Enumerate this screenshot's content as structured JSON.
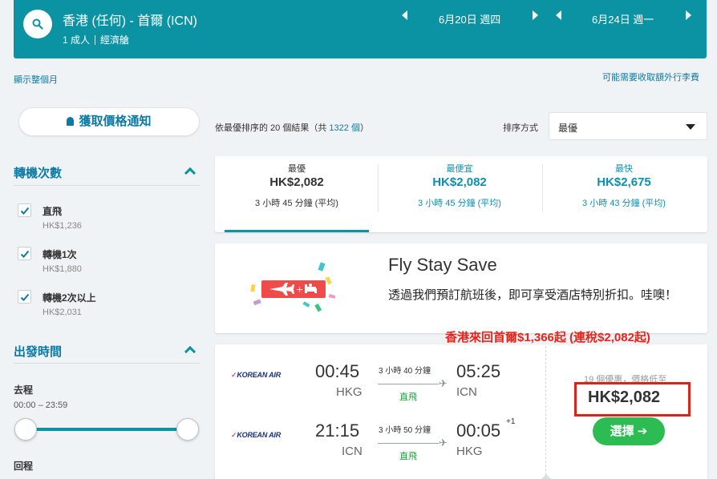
{
  "header": {
    "route": "香港 (任何) - 首爾 (ICN)",
    "passengers": "1 成人",
    "cabin": "經濟艙",
    "depart_date": "6月20日 週四",
    "return_date": "6月24日 週一",
    "bg_color": "#0b93a4"
  },
  "links": {
    "show_month": "顯示整個月",
    "baggage_fee": "可能需要收取額外行李費"
  },
  "sidebar": {
    "alert_button": "獲取價格通知",
    "stops_title": "轉機次數",
    "stops": [
      {
        "label": "直飛",
        "price": "HK$1,236",
        "checked": true
      },
      {
        "label": "轉機1次",
        "price": "HK$1,880",
        "checked": true
      },
      {
        "label": "轉機2次以上",
        "price": "HK$2,031",
        "checked": true
      }
    ],
    "times_title": "出發時間",
    "outbound_label": "去程",
    "outbound_range": "00:00 – 23:59",
    "return_label": "回程"
  },
  "results": {
    "prefix": "依最優排序的 20 個結果（共",
    "total": "1322 個",
    "suffix": "）",
    "sort_label": "排序方式",
    "sort_value": "最優"
  },
  "tabs": [
    {
      "title": "最優",
      "price": "HK$2,082",
      "duration": "3 小時 45 分鐘 (平均)",
      "active": true
    },
    {
      "title": "最便宜",
      "price": "HK$2,082",
      "duration": "3 小時 45 分鐘 (平均)",
      "active": false
    },
    {
      "title": "最快",
      "price": "HK$2,675",
      "duration": "3 小時 43 分鐘 (平均)",
      "active": false
    }
  ],
  "promo_card": {
    "title": "Fly Stay Save",
    "text": "透過我們預訂航班後，即可享受酒店特別折扣。哇噢！"
  },
  "promo_banner": "香港來回首爾$1,366起 (連稅$2,082起)",
  "flight": {
    "airline": "KOREAN AIR",
    "legs": [
      {
        "dep_time": "00:45",
        "dep_code": "HKG",
        "duration": "3 小時 40 分鐘",
        "stops": "直飛",
        "arr_time": "05:25",
        "arr_code": "ICN",
        "day_offset": ""
      },
      {
        "dep_time": "21:15",
        "dep_code": "ICN",
        "duration": "3 小時 50 分鐘",
        "stops": "直飛",
        "arr_time": "00:05",
        "arr_code": "HKG",
        "day_offset": "+1"
      }
    ],
    "deals_text": "19 個優惠，價格低至",
    "price": "HK$2,082",
    "select_label": "選擇 ➔"
  }
}
